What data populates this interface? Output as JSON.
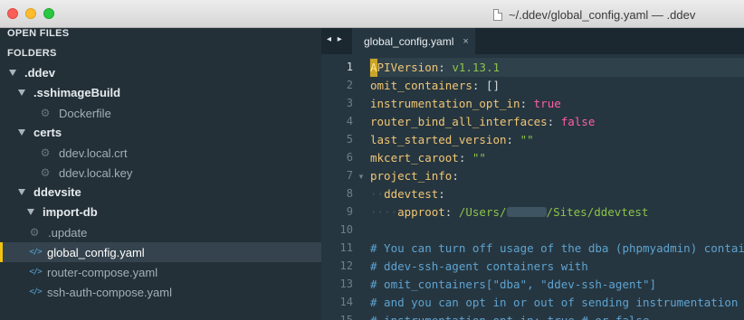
{
  "window": {
    "title": "~/.ddev/global_config.yaml — .ddev"
  },
  "sidebar": {
    "open_files_label": "OPEN FILES",
    "folders_label": "FOLDERS",
    "tree": {
      "root": ".ddev",
      "sshimagebuild": ".sshimageBuild",
      "dockerfile": "Dockerfile",
      "certs": "certs",
      "crt": "ddev.local.crt",
      "key": "ddev.local.key",
      "ddevsite": "ddevsite",
      "importdb": "import-db",
      "update": ".update",
      "global_config": "global_config.yaml",
      "router_compose": "router-compose.yaml",
      "ssh_auth_compose": "ssh-auth-compose.yaml"
    }
  },
  "editor": {
    "tab_nav": "◂ ▸",
    "tab": {
      "label": "global_config.yaml",
      "close": "×"
    },
    "active_line": 1,
    "line_numbers": [
      "1",
      "2",
      "3",
      "4",
      "5",
      "6",
      "7",
      "8",
      "9",
      "10",
      "11",
      "12",
      "13",
      "14",
      "15"
    ],
    "code": {
      "l1": {
        "cursor": "A",
        "key": "PIVersion",
        "colon": ": ",
        "value": "v1.13.1"
      },
      "l2": {
        "key": "omit_containers",
        "colon": ": ",
        "value": "[]"
      },
      "l3": {
        "key": "instrumentation_opt_in",
        "colon": ": ",
        "value": "true"
      },
      "l4": {
        "key": "router_bind_all_interfaces",
        "colon": ": ",
        "value": "false"
      },
      "l5": {
        "key": "last_started_version",
        "colon": ": ",
        "value": "\"\""
      },
      "l6": {
        "key": "mkcert_caroot",
        "colon": ": ",
        "value": "\"\""
      },
      "l7": {
        "key": "project_info",
        "colon": ":"
      },
      "l8": {
        "indent": "··",
        "key": "ddevtest",
        "colon": ":"
      },
      "l9": {
        "indent": "····",
        "key": "approot",
        "colon": ": ",
        "value_a": "/Users/",
        "value_b": "/Sites/ddevtest"
      },
      "l11": "# You can turn off usage of the dba (phpmyadmin) container",
      "l12": "# ddev-ssh-agent containers with",
      "l13": "# omit_containers[\"dba\", \"ddev-ssh-agent\"]",
      "l14": "# and you can opt in or out of sending instrumentation the",
      "l15": "# instrumentation_opt_in: true # or false"
    }
  },
  "colors": {
    "sidebar_bg": "#243038",
    "editor_bg": "#263640",
    "selection_accent": "#f1c40f",
    "key": "#f0c674",
    "string": "#8bc34a",
    "boolean": "#ff5fa2",
    "comment": "#5ea3d0"
  }
}
